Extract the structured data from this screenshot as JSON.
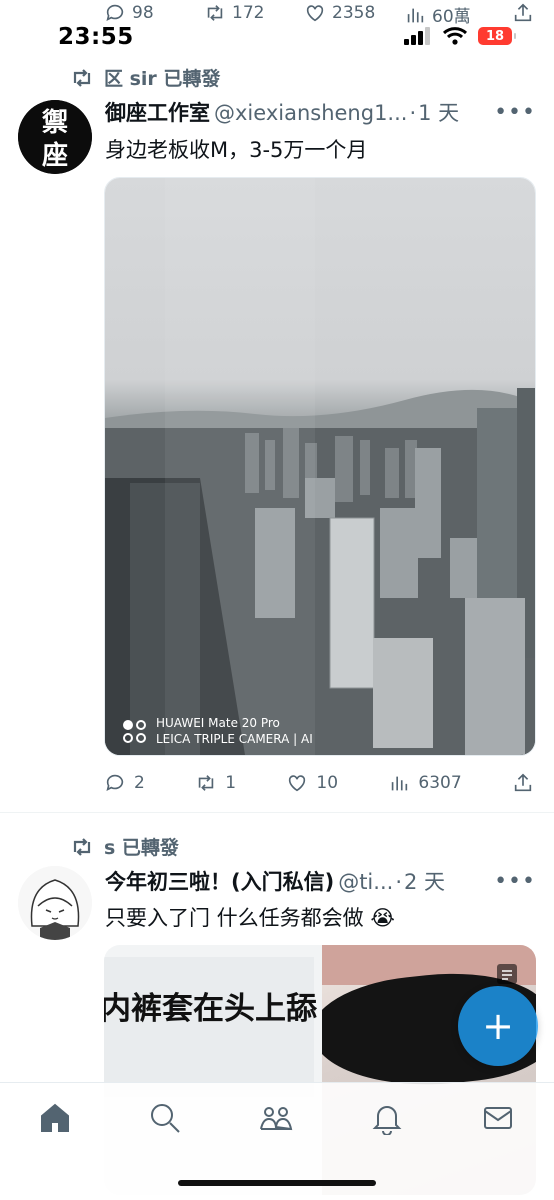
{
  "prev_tweet_actions": {
    "reply_count": "98",
    "retweet_count": "172",
    "like_count": "2358",
    "view_count": "60萬"
  },
  "status_bar": {
    "time": "23:55",
    "battery": "18"
  },
  "tweet1": {
    "retweeted_by": "区 sir 已轉發",
    "avatar_text": "禦座",
    "display_name": "御座工作室",
    "handle": "@xiexiansheng1...",
    "dot": "·",
    "time": "1 天",
    "more": "•••",
    "text": "身边老板收M，3-5万一个月",
    "photo_watermark_line1": "HUAWEI Mate 20 Pro",
    "photo_watermark_line2": "LEICA TRIPLE CAMERA | AI",
    "reply_count": "2",
    "retweet_count": "1",
    "like_count": "10",
    "view_count": "6307"
  },
  "tweet2": {
    "retweeted_by": "s 已轉發",
    "display_name": "今年初三啦！(入门私信)",
    "handle": "@ti...",
    "dot": "·",
    "time": "2 天",
    "more": "•••",
    "text": "只要入了门 什么任务都会做 😭",
    "media_left_text": "内裤套在头上舔"
  },
  "colors": {
    "accent": "#1d9bf0",
    "secondary_text": "#536471",
    "battery_low": "#ff3b30"
  },
  "fab": {
    "icon": "plus-icon",
    "label": "+"
  },
  "bottom_nav": [
    "home-icon",
    "search-icon",
    "communities-icon",
    "bell-icon",
    "mail-icon"
  ]
}
